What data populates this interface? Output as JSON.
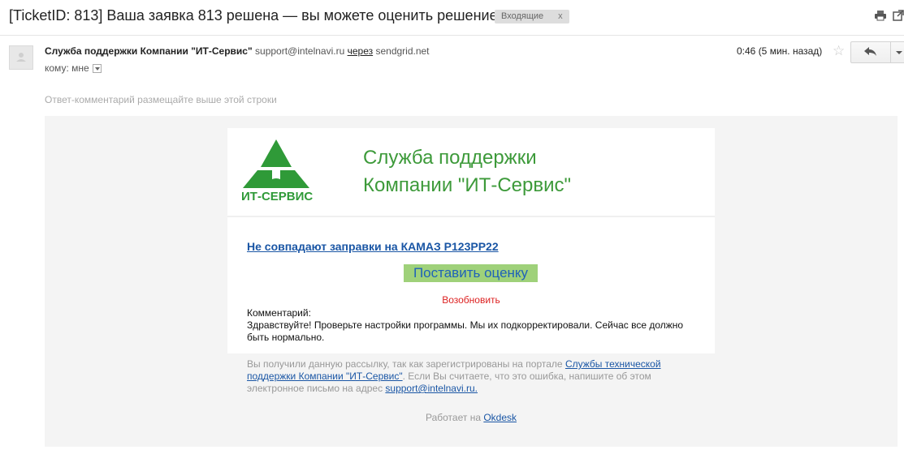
{
  "email": {
    "subject": "[TicketID: 813] Ваша заявка 813 решена — вы можете оценить решение",
    "label": "Входящие",
    "label_close": "x",
    "sender_name": "Служба поддержки Компании \"ИТ-Сервис\"",
    "sender_email": "support@intelnavi.ru",
    "via_label": "через",
    "via_domain": "sendgrid.net",
    "to_label": "кому: мне",
    "time": "0:46 (5 мин. назад)",
    "reply_hint": "Ответ-комментарий размещайте выше этой строки"
  },
  "body": {
    "logo_text": "ИТ-СЕРВИС",
    "brand_line1": "Служба поддержки",
    "brand_line2": "Компании \"ИТ-Сервис\"",
    "ticket_title": "Не совпадают заправки на КАМАЗ Р123РР22",
    "rate_button": "Поставить оценку",
    "reopen_link": "Возобновить",
    "comment_label": "Комментарий:",
    "comment_text": "Здравствуйте! Проверьте настройки программы. Мы их подкорректировали. Сейчас все должно быть нормально.",
    "footer_pre": "Вы получили данную рассылку, так как зарегистрированы на портале ",
    "footer_link": "Службы технической поддержки Компании \"ИТ-Сервис\"",
    "footer_mid": ". Если Вы считаете, что это ошибка, напишите об этом электронное письмо на адрес ",
    "footer_email": "support@intelnavi.ru.",
    "powered_pre": "Работает на ",
    "powered_link": "Okdesk"
  },
  "colors": {
    "brand_green": "#3d9a3a",
    "link_blue": "#1a56a5",
    "rate_button_bg": "#9fd17a",
    "reopen_red": "#dd2222"
  },
  "icons": [
    "print-icon",
    "new-window-icon",
    "avatar-icon",
    "star-icon",
    "reply-icon",
    "more-dropdown-icon",
    "logo-icon"
  ]
}
